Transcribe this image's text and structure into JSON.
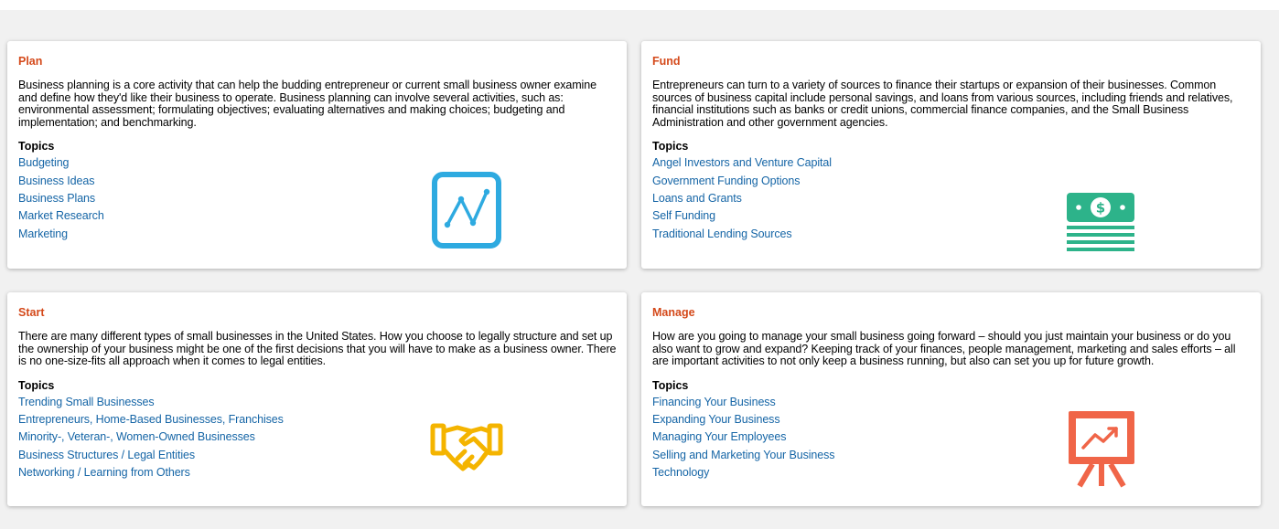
{
  "colors": {
    "title": "#d4491a",
    "link": "#1565a6",
    "plan_icon": "#2eaae0",
    "fund_icon": "#2db38a",
    "start_icon": "#f4b400",
    "manage_icon": "#f06548"
  },
  "cards": [
    {
      "title": "Plan",
      "description": "Business planning is a core activity that can help the budding entrepreneur or current small business owner examine and define how they'd like their business to operate. Business planning can involve several activities, such as: environmental assessment; formulating objectives; evaluating alternatives and making choices; budgeting and implementation; and benchmarking.",
      "topics_label": "Topics",
      "topics": [
        "Budgeting",
        "Business Ideas",
        "Business Plans",
        "Market Research",
        "Marketing"
      ],
      "icon": "line-chart-icon"
    },
    {
      "title": "Fund",
      "description": "Entrepreneurs can turn to a variety of sources to finance their startups or expansion of their businesses. Common sources of business capital include personal savings, and loans from various sources, including friends and relatives, financial institutions such as banks or credit unions, commercial finance companies, and the Small Business Administration and other government agencies.",
      "topics_label": "Topics",
      "topics": [
        "Angel Investors and Venture Capital",
        "Government Funding Options",
        "Loans and Grants",
        "Self Funding",
        "Traditional Lending Sources"
      ],
      "icon": "money-stack-icon"
    },
    {
      "title": "Start",
      "description": "There are many different types of small businesses in the United States. How you choose to legally structure and set up the ownership of your business might be one of the first decisions that you will have to make as a business owner. There is no one-size-fits all approach when it comes to legal entities.",
      "topics_label": "Topics",
      "topics": [
        "Trending Small Businesses",
        "Entrepreneurs, Home-Based Businesses, Franchises",
        "Minority-, Veteran-, Women-Owned Businesses",
        "Business Structures / Legal Entities",
        "Networking / Learning from Others"
      ],
      "icon": "handshake-icon"
    },
    {
      "title": "Manage",
      "description": "How are you going to manage your small business going forward – should you just maintain your business or do you also want to grow and expand? Keeping track of your finances, people management, marketing and sales efforts – all are important activities to not only keep a business running, but also can set you up for future growth.",
      "topics_label": "Topics",
      "topics": [
        "Financing Your Business",
        "Expanding Your Business",
        "Managing Your Employees",
        "Selling and Marketing Your Business",
        "Technology"
      ],
      "icon": "presentation-board-icon"
    }
  ]
}
